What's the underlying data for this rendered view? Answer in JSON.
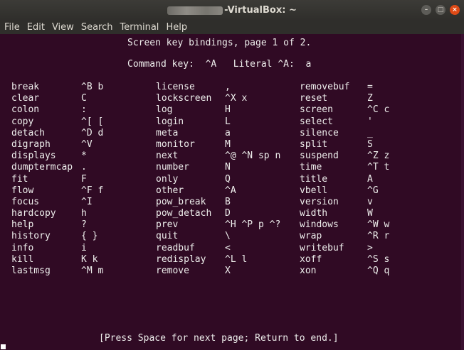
{
  "window": {
    "title_suffix": "-VirtualBox: ~",
    "buttons": {
      "minimize": "–",
      "maximize": "□",
      "close": "×"
    }
  },
  "menu": [
    "File",
    "Edit",
    "View",
    "Search",
    "Terminal",
    "Help"
  ],
  "terminal": {
    "header1": "Screen key bindings, page 1 of 2.",
    "header2": "Command key:  ^A   Literal ^A:  a",
    "rows": [
      [
        [
          "break",
          "^B b"
        ],
        [
          "license",
          ","
        ],
        [
          "removebuf",
          "="
        ]
      ],
      [
        [
          "clear",
          "C"
        ],
        [
          "lockscreen",
          "^X x"
        ],
        [
          "reset",
          "Z"
        ]
      ],
      [
        [
          "colon",
          ":"
        ],
        [
          "log",
          "H"
        ],
        [
          "screen",
          "^C c"
        ]
      ],
      [
        [
          "copy",
          "^[ ["
        ],
        [
          "login",
          "L"
        ],
        [
          "select",
          "'"
        ]
      ],
      [
        [
          "detach",
          "^D d"
        ],
        [
          "meta",
          "a"
        ],
        [
          "silence",
          "_"
        ]
      ],
      [
        [
          "digraph",
          "^V"
        ],
        [
          "monitor",
          "M"
        ],
        [
          "split",
          "S"
        ]
      ],
      [
        [
          "displays",
          "*"
        ],
        [
          "next",
          "^@ ^N sp n"
        ],
        [
          "suspend",
          "^Z z"
        ]
      ],
      [
        [
          "dumptermcap",
          "."
        ],
        [
          "number",
          "N"
        ],
        [
          "time",
          "^T t"
        ]
      ],
      [
        [
          "fit",
          "F"
        ],
        [
          "only",
          "Q"
        ],
        [
          "title",
          "A"
        ]
      ],
      [
        [
          "flow",
          "^F f"
        ],
        [
          "other",
          "^A"
        ],
        [
          "vbell",
          "^G"
        ]
      ],
      [
        [
          "focus",
          "^I"
        ],
        [
          "pow_break",
          "B"
        ],
        [
          "version",
          "v"
        ]
      ],
      [
        [
          "hardcopy",
          "h"
        ],
        [
          "pow_detach",
          "D"
        ],
        [
          "width",
          "W"
        ]
      ],
      [
        [
          "help",
          "?"
        ],
        [
          "prev",
          "^H ^P p ^?"
        ],
        [
          "windows",
          "^W w"
        ]
      ],
      [
        [
          "history",
          "{ }"
        ],
        [
          "quit",
          "\\"
        ],
        [
          "wrap",
          "^R r"
        ]
      ],
      [
        [
          "info",
          "i"
        ],
        [
          "readbuf",
          "<"
        ],
        [
          "writebuf",
          ">"
        ]
      ],
      [
        [
          "kill",
          "K k"
        ],
        [
          "redisplay",
          "^L l"
        ],
        [
          "xoff",
          "^S s"
        ]
      ],
      [
        [
          "lastmsg",
          "^M m"
        ],
        [
          "remove",
          "X"
        ],
        [
          "xon",
          "^Q q"
        ]
      ]
    ],
    "footer": "[Press Space for next page; Return to end.]"
  }
}
